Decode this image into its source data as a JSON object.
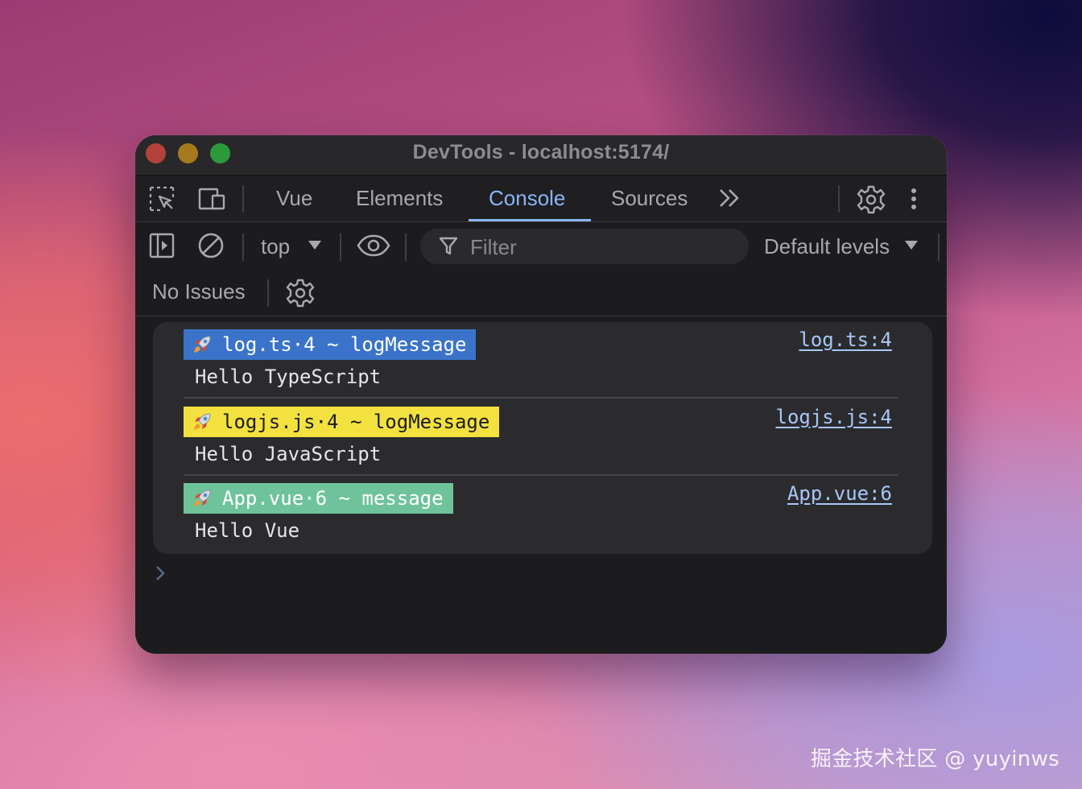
{
  "window": {
    "title": "DevTools - localhost:5174/"
  },
  "tabs": [
    {
      "label": "Vue",
      "active": false
    },
    {
      "label": "Elements",
      "active": false
    },
    {
      "label": "Console",
      "active": true
    },
    {
      "label": "Sources",
      "active": false
    }
  ],
  "filterbar": {
    "context": "top",
    "filter_placeholder": "Filter",
    "levels": "Default levels"
  },
  "issues": {
    "label": "No Issues"
  },
  "messages": [
    {
      "badge": "log.ts·4 ~ logMessage",
      "badge_color": "#3a73c9",
      "text": "Hello TypeScript",
      "source": "log.ts:4"
    },
    {
      "badge": "logjs.js·4 ~ logMessage",
      "badge_color": "#f3e13f",
      "text": "Hello JavaScript",
      "source": "logjs.js:4"
    },
    {
      "badge": "App.vue·6 ~ message",
      "badge_color": "#6fc39a",
      "text": "Hello Vue",
      "source": "App.vue:6"
    }
  ],
  "icons": {
    "badge": "rocket-icon",
    "toolbar": [
      "inspect-element-icon",
      "device-toolbar-icon",
      "more-tabs-icon",
      "settings-gear-icon",
      "more-options-icon"
    ],
    "filterbar": [
      "sidebar-toggle-icon",
      "clear-console-icon",
      "dropdown-arrow-icon",
      "eye-icon",
      "filter-funnel-icon"
    ]
  },
  "watermark": "掘金技术社区 @ yuyinws"
}
